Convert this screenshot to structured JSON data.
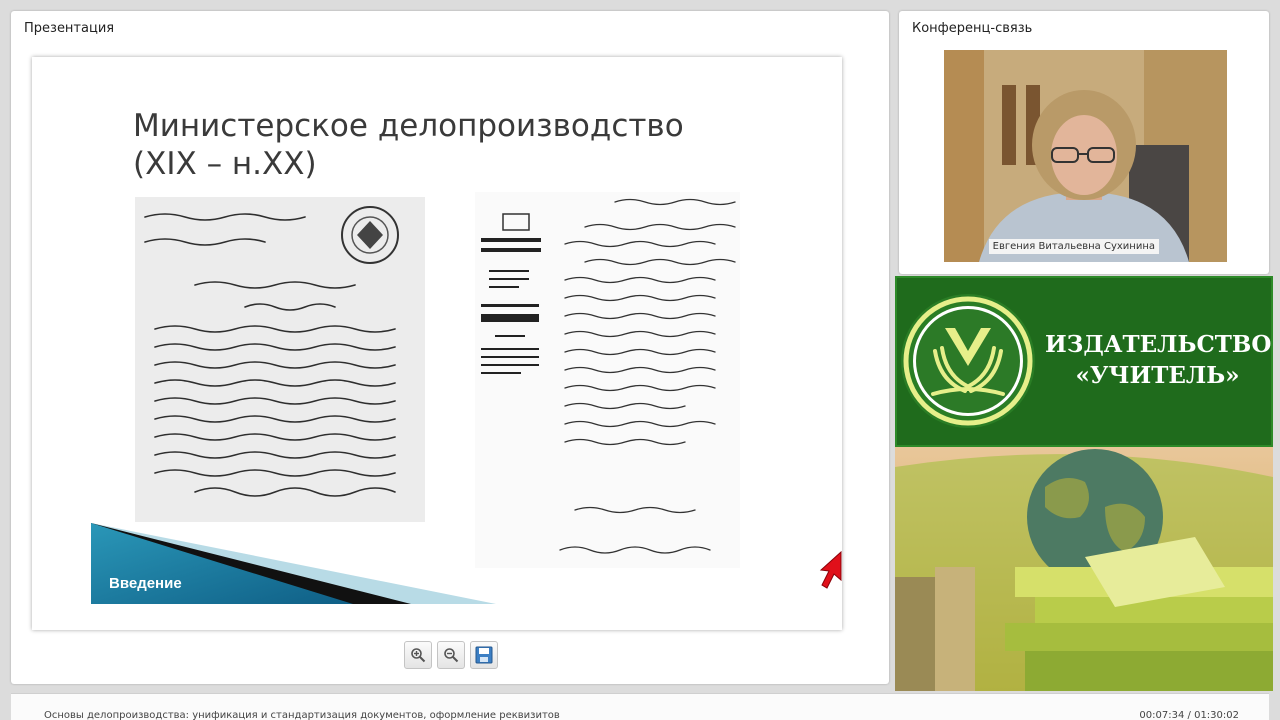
{
  "presentation": {
    "title": "Презентация",
    "slide": {
      "heading_line1": "Министерское делопроизводство",
      "heading_line2": "(XIX – н.XX)",
      "banner_label": "Введение"
    },
    "toolbar": {
      "zoom_in": "zoom-in-icon",
      "zoom_out": "zoom-out-icon",
      "save": "save-icon"
    }
  },
  "conference": {
    "title": "Конференц-связь",
    "speaker_name": "Евгения Витальевна Сухинина"
  },
  "publisher": {
    "line1": "ИЗДАТЕЛЬСТВО",
    "line2": "«УЧИТЕЛЬ»"
  },
  "status_bar": {
    "course_title": "Основы делопроизводства: унификация и стандартизация документов, оформление реквизитов",
    "elapsed": "00:07:34",
    "total": "01:30:02",
    "separator": " / "
  },
  "colors": {
    "accent_green": "#1f6b1c",
    "banner_blue": "#1a7da0",
    "pointer_red": "#e0101a"
  }
}
